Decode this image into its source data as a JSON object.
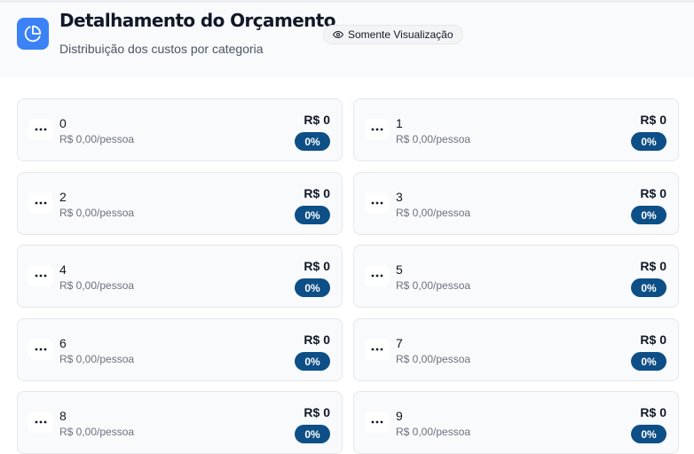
{
  "header": {
    "title": "Detalhamento do Orçamento",
    "subtitle": "Distribuição dos custos por categoria",
    "view_badge": "Somente Visualização",
    "icon": "pie-chart-icon",
    "accent_color": "#3b82f6"
  },
  "categories": [
    {
      "name": "0",
      "amount": "R$ 0",
      "per_person": "R$ 0,00/pessoa",
      "percent": "0%"
    },
    {
      "name": "1",
      "amount": "R$ 0",
      "per_person": "R$ 0,00/pessoa",
      "percent": "0%"
    },
    {
      "name": "2",
      "amount": "R$ 0",
      "per_person": "R$ 0,00/pessoa",
      "percent": "0%"
    },
    {
      "name": "3",
      "amount": "R$ 0",
      "per_person": "R$ 0,00/pessoa",
      "percent": "0%"
    },
    {
      "name": "4",
      "amount": "R$ 0",
      "per_person": "R$ 0,00/pessoa",
      "percent": "0%"
    },
    {
      "name": "5",
      "amount": "R$ 0",
      "per_person": "R$ 0,00/pessoa",
      "percent": "0%"
    },
    {
      "name": "6",
      "amount": "R$ 0",
      "per_person": "R$ 0,00/pessoa",
      "percent": "0%"
    },
    {
      "name": "7",
      "amount": "R$ 0",
      "per_person": "R$ 0,00/pessoa",
      "percent": "0%"
    },
    {
      "name": "8",
      "amount": "R$ 0",
      "per_person": "R$ 0,00/pessoa",
      "percent": "0%"
    },
    {
      "name": "9",
      "amount": "R$ 0",
      "per_person": "R$ 0,00/pessoa",
      "percent": "0%"
    }
  ],
  "colors": {
    "percent_badge": "#0d4f86",
    "card_background": "#f9fafb",
    "card_border": "#e5e7eb"
  }
}
